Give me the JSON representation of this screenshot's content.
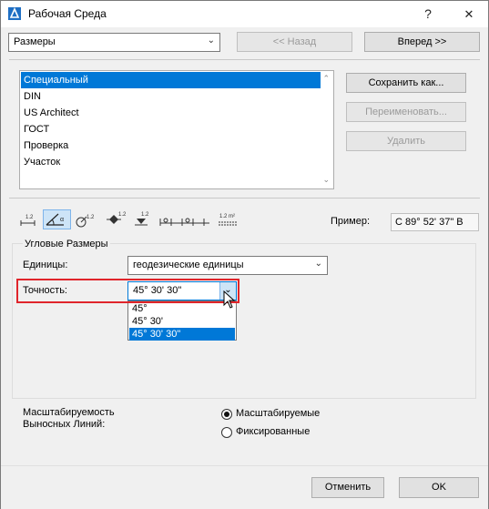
{
  "window": {
    "title": "Рабочая Среда",
    "help_label": "?",
    "close_label": "✕"
  },
  "top": {
    "combo_value": "Размеры",
    "back_label": "<< Назад",
    "forward_label": "Вперед >>"
  },
  "list": {
    "items": [
      {
        "label": "Специальный",
        "selected": true
      },
      {
        "label": "DIN",
        "selected": false
      },
      {
        "label": "US Architect",
        "selected": false
      },
      {
        "label": "ГОСТ",
        "selected": false
      },
      {
        "label": "Проверка",
        "selected": false
      },
      {
        "label": "Участок",
        "selected": false
      }
    ]
  },
  "side_buttons": {
    "save_as": "Сохранить как...",
    "rename": "Переименовать...",
    "delete": "Удалить"
  },
  "toolbar": {
    "icons": [
      "linear-dimension-icon",
      "angular-dimension-icon",
      "radial-dimension-icon",
      "level-dimension-icon",
      "elevation-dimension-icon",
      "detail-dimension-icon",
      "area-dimension-icon"
    ],
    "tab_labels": [
      "1.2",
      "α",
      "1.2",
      "1.2",
      "1.2",
      "",
      "1.2 m²"
    ],
    "example_label": "Пример:",
    "example_value": "С 89° 52' 37\" В"
  },
  "angular": {
    "group_label": "Угловые Размеры",
    "units_label": "Единицы:",
    "units_value": "геодезические единицы",
    "precision_label": "Точность:",
    "precision_value": "45° 30' 30\"",
    "precision_options": [
      {
        "label": "45°",
        "selected": false
      },
      {
        "label": "45° 30'",
        "selected": false
      },
      {
        "label": "45° 30' 30\"",
        "selected": true
      }
    ]
  },
  "scaling": {
    "label_line1": "Масштабируемость",
    "label_line2": "Выносных Линий:",
    "option_scalable": "Масштабируемые",
    "option_fixed": "Фиксированные",
    "selected": "scalable"
  },
  "footer": {
    "cancel_label": "Отменить",
    "ok_label": "OK"
  },
  "colors": {
    "selection": "#0078d7",
    "highlight_border": "#e0252b"
  }
}
